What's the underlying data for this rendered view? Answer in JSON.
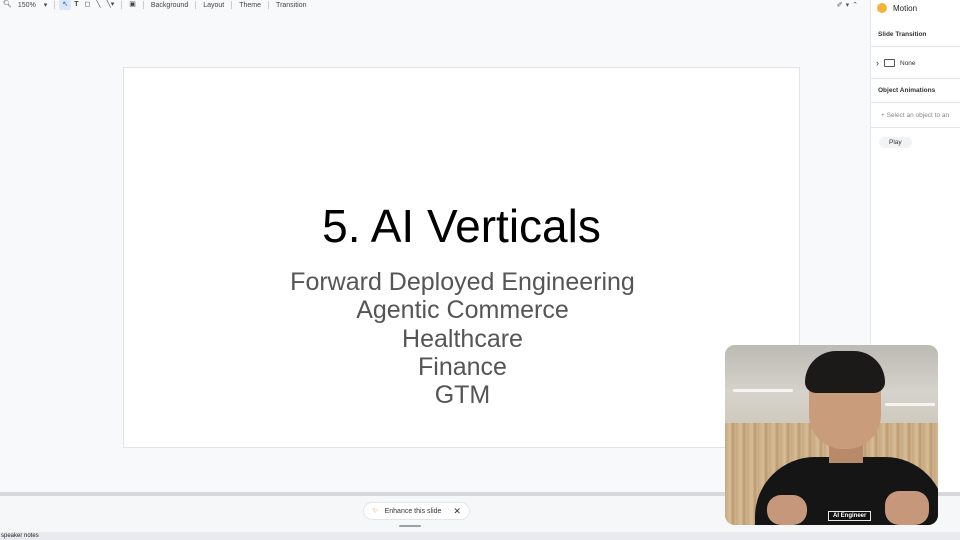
{
  "toolbar": {
    "zoom": "150%",
    "menu": [
      "Background",
      "Layout",
      "Theme",
      "Transition"
    ]
  },
  "slide": {
    "title": "5. AI Verticals",
    "lines": [
      "Forward Deployed Engineering",
      "Agentic Commerce",
      "Healthcare",
      "Finance",
      "GTM"
    ]
  },
  "panel": {
    "title": "Motion",
    "slide_transition_label": "Slide Transition",
    "transition_value": "None",
    "object_animations_label": "Object Animations",
    "add_object_hint": "Select an object to an",
    "play_label": "Play"
  },
  "bottom": {
    "enhance_label": "Enhance this slide",
    "speaker_notes": "speaker notes"
  },
  "webcam": {
    "shirt_text": "AI Engineer"
  },
  "colors": {
    "accent": "#1a55c9",
    "motion_icon": "#f3b23a",
    "body_text": "#555555"
  }
}
